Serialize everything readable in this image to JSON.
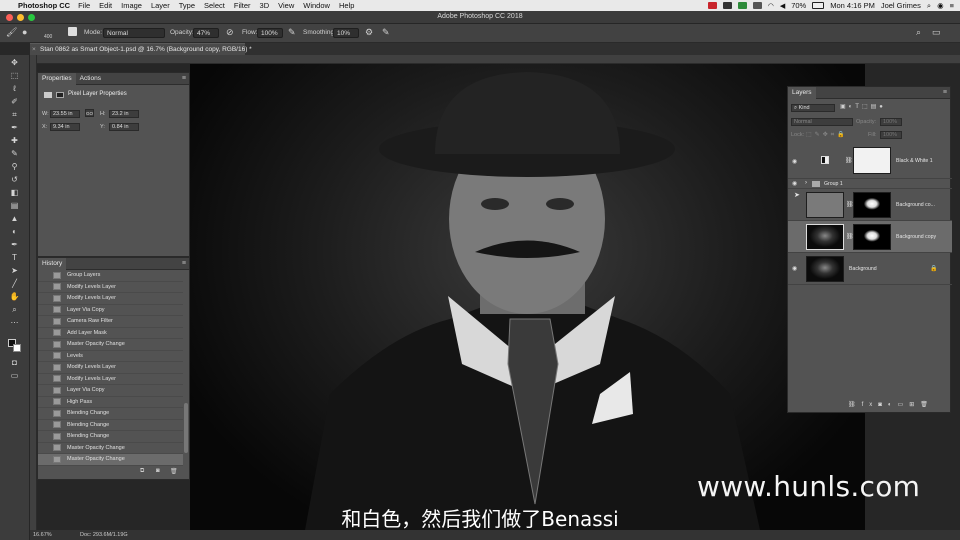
{
  "menubar": {
    "app_name": "Photoshop CC",
    "items": [
      "File",
      "Edit",
      "Image",
      "Layer",
      "Type",
      "Select",
      "Filter",
      "3D",
      "View",
      "Window",
      "Help"
    ],
    "battery": "70%",
    "clock": "Mon 4:16 PM",
    "user": "Joel Grimes"
  },
  "window": {
    "title": "Adobe Photoshop CC 2018"
  },
  "options_bar": {
    "brush_size": "400",
    "mode_label": "Mode:",
    "mode_value": "Normal",
    "opacity_label": "Opacity:",
    "opacity_value": "47%",
    "flow_label": "Flow:",
    "flow_value": "100%",
    "smoothing_label": "Smoothing:",
    "smoothing_value": "10%"
  },
  "document_tab": {
    "title": "Stan 0862 as Smart Object-1.psd @ 16.7% (Background copy, RGB/16) *"
  },
  "properties_panel": {
    "tabs": [
      "Properties",
      "Actions"
    ],
    "section_title": "Pixel Layer Properties",
    "w_label": "W:",
    "w_value": "23.55 in",
    "h_label": "H:",
    "h_value": "23.2 in",
    "x_label": "X:",
    "x_value": "9.34 in",
    "y_label": "Y:",
    "y_value": "0.84 in",
    "link_label": "GO"
  },
  "history_panel": {
    "title": "History",
    "items": [
      "Group Layers",
      "Modify Levels Layer",
      "Modify Levels Layer",
      "Layer Via Copy",
      "Camera Raw Filter",
      "Add Layer Mask",
      "Master Opacity Change",
      "Levels",
      "Modify Levels Layer",
      "Modify Levels Layer",
      "Layer Via Copy",
      "High Pass",
      "Blending Change",
      "Blending Change",
      "Blending Change",
      "Master Opacity Change",
      "Master Opacity Change"
    ],
    "selected_index": 16
  },
  "layers_panel": {
    "title": "Layers",
    "kind_label": "Kind",
    "blend_mode": "Normal",
    "opacity_label": "Opacity:",
    "opacity_value": "100%",
    "lock_label": "Lock:",
    "fill_label": "Fill:",
    "fill_value": "100%",
    "layers": [
      {
        "name": "Black & White 1",
        "visible": true
      },
      {
        "name": "Group 1",
        "visible": true
      },
      {
        "name": "Background co...",
        "visible": false
      },
      {
        "name": "Background copy",
        "visible": false
      },
      {
        "name": "Background",
        "visible": true
      }
    ]
  },
  "status_bar": {
    "zoom": "16.67%",
    "doc": "Doc: 293.6M/1.19G"
  },
  "overlay": {
    "watermark": "www.hunls.com",
    "subtitle": "和白色，然后我们做了Benassi"
  },
  "colors": {
    "accent_red": "#c8242b",
    "panel_bg": "#535353",
    "selected_row": "#6b6b6b"
  }
}
